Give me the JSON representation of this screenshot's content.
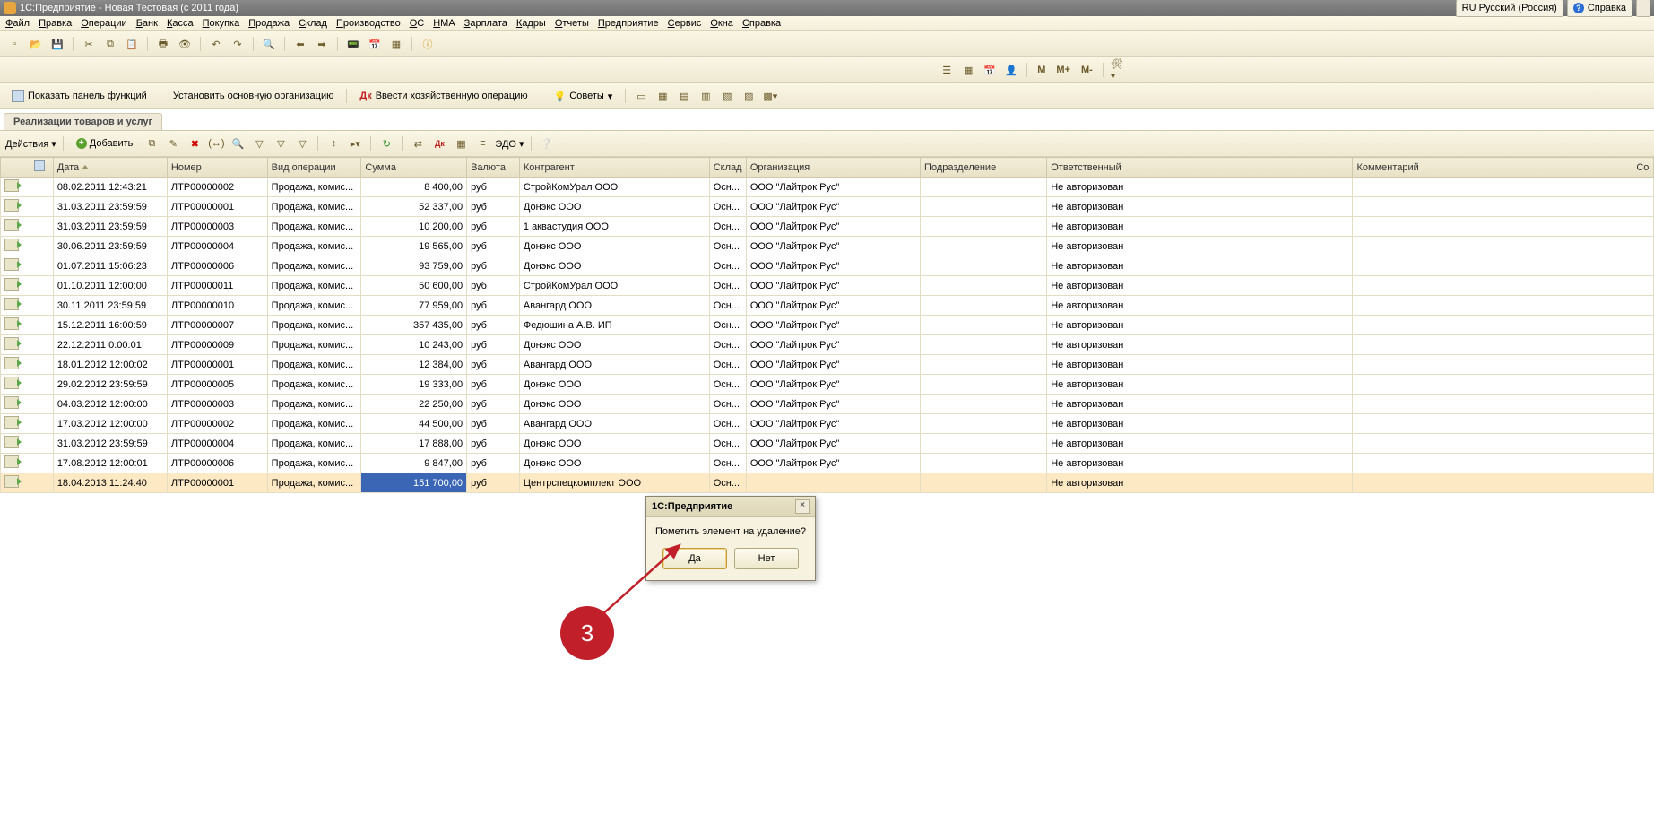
{
  "title": "1С:Предприятие - Новая Тестовая (с 2011 года)",
  "lang_label": "RU Русский (Россия)",
  "help_label": "Справка",
  "menu": [
    "Файл",
    "Правка",
    "Операции",
    "Банк",
    "Касса",
    "Покупка",
    "Продажа",
    "Склад",
    "Производство",
    "ОС",
    "НМА",
    "Зарплата",
    "Кадры",
    "Отчеты",
    "Предприятие",
    "Сервис",
    "Окна",
    "Справка"
  ],
  "toolbar2_m": [
    "M",
    "M+",
    "M-"
  ],
  "toolbar3": {
    "show_panel": "Показать панель функций",
    "set_org": "Установить основную организацию",
    "enter_op": "Ввести хозяйственную операцию",
    "tips": "Советы"
  },
  "doc_tab": "Реализации товаров и услуг",
  "actions": {
    "actions_label": "Действия",
    "add_label": "Добавить",
    "edo_label": "ЭДО"
  },
  "columns": {
    "icon": "",
    "flag": "",
    "date": "Дата",
    "num": "Номер",
    "optype": "Вид операции",
    "sum": "Сумма",
    "curr": "Валюта",
    "contr": "Контрагент",
    "wh": "Склад",
    "org": "Организация",
    "dept": "Подразделение",
    "resp": "Ответственный",
    "comment": "Комментарий",
    "extra": "Со"
  },
  "rows": [
    {
      "date": "08.02.2011 12:43:21",
      "num": "ЛТР00000002",
      "optype": "Продажа, комис...",
      "sum": "8 400,00",
      "curr": "руб",
      "contr": "СтройКомУрал ООО",
      "wh": "Осн...",
      "org": "ООО \"Лайтрок Рус\"",
      "resp": "Не авторизован"
    },
    {
      "date": "31.03.2011 23:59:59",
      "num": "ЛТР00000001",
      "optype": "Продажа, комис...",
      "sum": "52 337,00",
      "curr": "руб",
      "contr": "Донэкс ООО",
      "wh": "Осн...",
      "org": "ООО \"Лайтрок Рус\"",
      "resp": "Не авторизован"
    },
    {
      "date": "31.03.2011 23:59:59",
      "num": "ЛТР00000003",
      "optype": "Продажа, комис...",
      "sum": "10 200,00",
      "curr": "руб",
      "contr": "1 аквастудия ООО",
      "wh": "Осн...",
      "org": "ООО \"Лайтрок Рус\"",
      "resp": "Не авторизован"
    },
    {
      "date": "30.06.2011 23:59:59",
      "num": "ЛТР00000004",
      "optype": "Продажа, комис...",
      "sum": "19 565,00",
      "curr": "руб",
      "contr": "Донэкс ООО",
      "wh": "Осн...",
      "org": "ООО \"Лайтрок Рус\"",
      "resp": "Не авторизован"
    },
    {
      "date": "01.07.2011 15:06:23",
      "num": "ЛТР00000006",
      "optype": "Продажа, комис...",
      "sum": "93 759,00",
      "curr": "руб",
      "contr": "Донэкс ООО",
      "wh": "Осн...",
      "org": "ООО \"Лайтрок Рус\"",
      "resp": "Не авторизован"
    },
    {
      "date": "01.10.2011 12:00:00",
      "num": "ЛТР00000011",
      "optype": "Продажа, комис...",
      "sum": "50 600,00",
      "curr": "руб",
      "contr": "СтройКомУрал ООО",
      "wh": "Осн...",
      "org": "ООО \"Лайтрок Рус\"",
      "resp": "Не авторизован"
    },
    {
      "date": "30.11.2011 23:59:59",
      "num": "ЛТР00000010",
      "optype": "Продажа, комис...",
      "sum": "77 959,00",
      "curr": "руб",
      "contr": "Авангард ООО",
      "wh": "Осн...",
      "org": "ООО \"Лайтрок Рус\"",
      "resp": "Не авторизован"
    },
    {
      "date": "15.12.2011 16:00:59",
      "num": "ЛТР00000007",
      "optype": "Продажа, комис...",
      "sum": "357 435,00",
      "curr": "руб",
      "contr": "Федюшина А.В. ИП",
      "wh": "Осн...",
      "org": "ООО \"Лайтрок Рус\"",
      "resp": "Не авторизован"
    },
    {
      "date": "22.12.2011 0:00:01",
      "num": "ЛТР00000009",
      "optype": "Продажа, комис...",
      "sum": "10 243,00",
      "curr": "руб",
      "contr": "Донэкс ООО",
      "wh": "Осн...",
      "org": "ООО \"Лайтрок Рус\"",
      "resp": "Не авторизован"
    },
    {
      "date": "18.01.2012 12:00:02",
      "num": "ЛТР00000001",
      "optype": "Продажа, комис...",
      "sum": "12 384,00",
      "curr": "руб",
      "contr": "Авангард ООО",
      "wh": "Осн...",
      "org": "ООО \"Лайтрок Рус\"",
      "resp": "Не авторизован"
    },
    {
      "date": "29.02.2012 23:59:59",
      "num": "ЛТР00000005",
      "optype": "Продажа, комис...",
      "sum": "19 333,00",
      "curr": "руб",
      "contr": "Донэкс ООО",
      "wh": "Осн...",
      "org": "ООО \"Лайтрок Рус\"",
      "resp": "Не авторизован"
    },
    {
      "date": "04.03.2012 12:00:00",
      "num": "ЛТР00000003",
      "optype": "Продажа, комис...",
      "sum": "22 250,00",
      "curr": "руб",
      "contr": "Донэкс ООО",
      "wh": "Осн...",
      "org": "ООО \"Лайтрок Рус\"",
      "resp": "Не авторизован"
    },
    {
      "date": "17.03.2012 12:00:00",
      "num": "ЛТР00000002",
      "optype": "Продажа, комис...",
      "sum": "44 500,00",
      "curr": "руб",
      "contr": "Авангард ООО",
      "wh": "Осн...",
      "org": "ООО \"Лайтрок Рус\"",
      "resp": "Не авторизован"
    },
    {
      "date": "31.03.2012 23:59:59",
      "num": "ЛТР00000004",
      "optype": "Продажа, комис...",
      "sum": "17 888,00",
      "curr": "руб",
      "contr": "Донэкс ООО",
      "wh": "Осн...",
      "org": "ООО \"Лайтрок Рус\"",
      "resp": "Не авторизован"
    },
    {
      "date": "17.08.2012 12:00:01",
      "num": "ЛТР00000006",
      "optype": "Продажа, комис...",
      "sum": "9 847,00",
      "curr": "руб",
      "contr": "Донэкс ООО",
      "wh": "Осн...",
      "org": "ООО \"Лайтрок Рус\"",
      "resp": "Не авторизован"
    },
    {
      "date": "18.04.2013 11:24:40",
      "num": "ЛТР00000001",
      "optype": "Продажа, комис...",
      "sum": "151 700,00",
      "curr": "руб",
      "contr": "Центрспецкомплект ООО",
      "wh": "Осн...",
      "org": "",
      "resp": "Не авторизован",
      "selected": true
    }
  ],
  "dialog": {
    "title": "1С:Предприятие",
    "message": "Пометить элемент на удаление?",
    "yes": "Да",
    "no": "Нет"
  },
  "annotation_number": "3"
}
